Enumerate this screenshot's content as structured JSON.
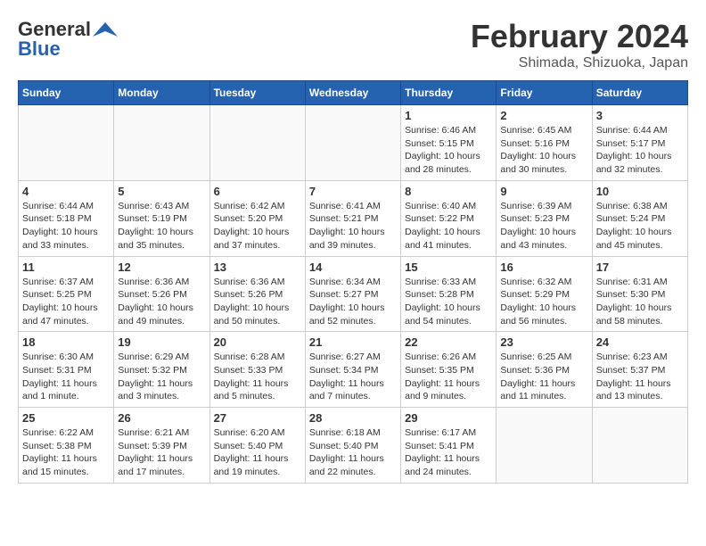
{
  "logo": {
    "line1": "General",
    "line2": "Blue"
  },
  "title": "February 2024",
  "location": "Shimada, Shizuoka, Japan",
  "days_of_week": [
    "Sunday",
    "Monday",
    "Tuesday",
    "Wednesday",
    "Thursday",
    "Friday",
    "Saturday"
  ],
  "weeks": [
    [
      {
        "day": "",
        "info": ""
      },
      {
        "day": "",
        "info": ""
      },
      {
        "day": "",
        "info": ""
      },
      {
        "day": "",
        "info": ""
      },
      {
        "day": "1",
        "info": "Sunrise: 6:46 AM\nSunset: 5:15 PM\nDaylight: 10 hours\nand 28 minutes."
      },
      {
        "day": "2",
        "info": "Sunrise: 6:45 AM\nSunset: 5:16 PM\nDaylight: 10 hours\nand 30 minutes."
      },
      {
        "day": "3",
        "info": "Sunrise: 6:44 AM\nSunset: 5:17 PM\nDaylight: 10 hours\nand 32 minutes."
      }
    ],
    [
      {
        "day": "4",
        "info": "Sunrise: 6:44 AM\nSunset: 5:18 PM\nDaylight: 10 hours\nand 33 minutes."
      },
      {
        "day": "5",
        "info": "Sunrise: 6:43 AM\nSunset: 5:19 PM\nDaylight: 10 hours\nand 35 minutes."
      },
      {
        "day": "6",
        "info": "Sunrise: 6:42 AM\nSunset: 5:20 PM\nDaylight: 10 hours\nand 37 minutes."
      },
      {
        "day": "7",
        "info": "Sunrise: 6:41 AM\nSunset: 5:21 PM\nDaylight: 10 hours\nand 39 minutes."
      },
      {
        "day": "8",
        "info": "Sunrise: 6:40 AM\nSunset: 5:22 PM\nDaylight: 10 hours\nand 41 minutes."
      },
      {
        "day": "9",
        "info": "Sunrise: 6:39 AM\nSunset: 5:23 PM\nDaylight: 10 hours\nand 43 minutes."
      },
      {
        "day": "10",
        "info": "Sunrise: 6:38 AM\nSunset: 5:24 PM\nDaylight: 10 hours\nand 45 minutes."
      }
    ],
    [
      {
        "day": "11",
        "info": "Sunrise: 6:37 AM\nSunset: 5:25 PM\nDaylight: 10 hours\nand 47 minutes."
      },
      {
        "day": "12",
        "info": "Sunrise: 6:36 AM\nSunset: 5:26 PM\nDaylight: 10 hours\nand 49 minutes."
      },
      {
        "day": "13",
        "info": "Sunrise: 6:36 AM\nSunset: 5:26 PM\nDaylight: 10 hours\nand 50 minutes."
      },
      {
        "day": "14",
        "info": "Sunrise: 6:34 AM\nSunset: 5:27 PM\nDaylight: 10 hours\nand 52 minutes."
      },
      {
        "day": "15",
        "info": "Sunrise: 6:33 AM\nSunset: 5:28 PM\nDaylight: 10 hours\nand 54 minutes."
      },
      {
        "day": "16",
        "info": "Sunrise: 6:32 AM\nSunset: 5:29 PM\nDaylight: 10 hours\nand 56 minutes."
      },
      {
        "day": "17",
        "info": "Sunrise: 6:31 AM\nSunset: 5:30 PM\nDaylight: 10 hours\nand 58 minutes."
      }
    ],
    [
      {
        "day": "18",
        "info": "Sunrise: 6:30 AM\nSunset: 5:31 PM\nDaylight: 11 hours\nand 1 minute."
      },
      {
        "day": "19",
        "info": "Sunrise: 6:29 AM\nSunset: 5:32 PM\nDaylight: 11 hours\nand 3 minutes."
      },
      {
        "day": "20",
        "info": "Sunrise: 6:28 AM\nSunset: 5:33 PM\nDaylight: 11 hours\nand 5 minutes."
      },
      {
        "day": "21",
        "info": "Sunrise: 6:27 AM\nSunset: 5:34 PM\nDaylight: 11 hours\nand 7 minutes."
      },
      {
        "day": "22",
        "info": "Sunrise: 6:26 AM\nSunset: 5:35 PM\nDaylight: 11 hours\nand 9 minutes."
      },
      {
        "day": "23",
        "info": "Sunrise: 6:25 AM\nSunset: 5:36 PM\nDaylight: 11 hours\nand 11 minutes."
      },
      {
        "day": "24",
        "info": "Sunrise: 6:23 AM\nSunset: 5:37 PM\nDaylight: 11 hours\nand 13 minutes."
      }
    ],
    [
      {
        "day": "25",
        "info": "Sunrise: 6:22 AM\nSunset: 5:38 PM\nDaylight: 11 hours\nand 15 minutes."
      },
      {
        "day": "26",
        "info": "Sunrise: 6:21 AM\nSunset: 5:39 PM\nDaylight: 11 hours\nand 17 minutes."
      },
      {
        "day": "27",
        "info": "Sunrise: 6:20 AM\nSunset: 5:40 PM\nDaylight: 11 hours\nand 19 minutes."
      },
      {
        "day": "28",
        "info": "Sunrise: 6:18 AM\nSunset: 5:40 PM\nDaylight: 11 hours\nand 22 minutes."
      },
      {
        "day": "29",
        "info": "Sunrise: 6:17 AM\nSunset: 5:41 PM\nDaylight: 11 hours\nand 24 minutes."
      },
      {
        "day": "",
        "info": ""
      },
      {
        "day": "",
        "info": ""
      }
    ]
  ]
}
